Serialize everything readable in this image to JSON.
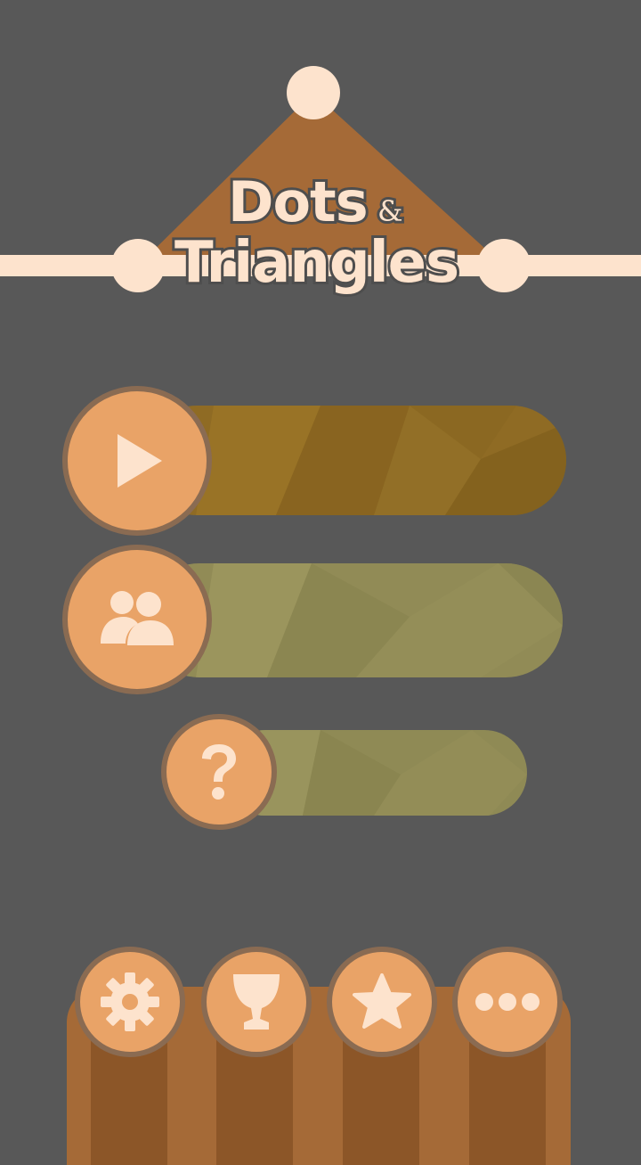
{
  "logo": {
    "title_line1": "Dots",
    "title_amp": "&",
    "title_line2": "Triangles"
  },
  "menu": {
    "play": {
      "icon": "play-icon"
    },
    "multiplayer": {
      "icon": "two-users-icon"
    },
    "help": {
      "icon": "question-mark-icon"
    }
  },
  "bottom_bar": {
    "buttons": [
      {
        "icon": "gear-icon"
      },
      {
        "icon": "trophy-icon"
      },
      {
        "icon": "star-icon"
      },
      {
        "icon": "more-dots-icon"
      }
    ]
  },
  "colors": {
    "background": "#585858",
    "cream": "#fde3cd",
    "orange": "#e9a367",
    "brown_triangle": "#a56a37",
    "bar_play": "#8f6b24",
    "bar_multi": "#918b56",
    "bar_help": "#8f8a55"
  }
}
